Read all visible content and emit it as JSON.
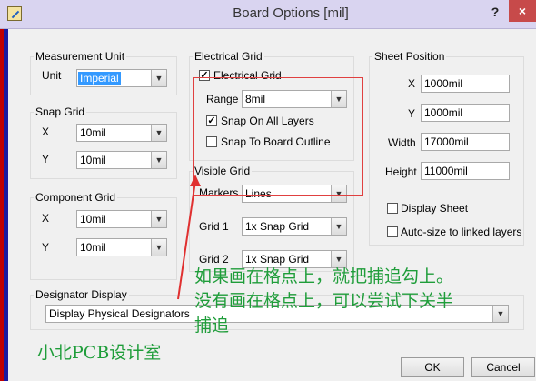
{
  "window": {
    "title": "Board Options [mil]",
    "help": "?",
    "close": "×"
  },
  "measurement": {
    "legend": "Measurement Unit",
    "unit_label": "Unit",
    "unit_value": "Imperial"
  },
  "snap": {
    "legend": "Snap Grid",
    "x_label": "X",
    "x_value": "10mil",
    "y_label": "Y",
    "y_value": "10mil"
  },
  "component": {
    "legend": "Component Grid",
    "x_label": "X",
    "x_value": "10mil",
    "y_label": "Y",
    "y_value": "10mil"
  },
  "electrical": {
    "legend": "Electrical Grid",
    "enable_label": "Electrical Grid",
    "range_label": "Range",
    "range_value": "8mil",
    "snap_layers_label": "Snap On All Layers",
    "snap_outline_label": "Snap To Board Outline"
  },
  "visible": {
    "legend": "Visible Grid",
    "markers_label": "Markers",
    "markers_value": "Lines",
    "grid1_label": "Grid 1",
    "grid1_value": "1x Snap Grid",
    "grid2_label": "Grid 2",
    "grid2_value": "1x Snap Grid"
  },
  "sheet": {
    "legend": "Sheet Position",
    "x_label": "X",
    "x_value": "1000mil",
    "y_label": "Y",
    "y_value": "1000mil",
    "width_label": "Width",
    "width_value": "17000mil",
    "height_label": "Height",
    "height_value": "11000mil",
    "display_label": "Display Sheet",
    "autosize_label": "Auto-size to linked layers"
  },
  "designator": {
    "legend": "Designator Display",
    "value": "Display Physical Designators"
  },
  "annotation": {
    "line1": "如果画在格点上，就把捕追勾上。",
    "line2": "没有画在格点上，可以尝试下关半",
    "line3": "捕追",
    "watermark": "小北PCB设计室",
    "color": "#1f9d3a"
  },
  "buttons": {
    "ok": "OK",
    "cancel": "Cancel"
  }
}
